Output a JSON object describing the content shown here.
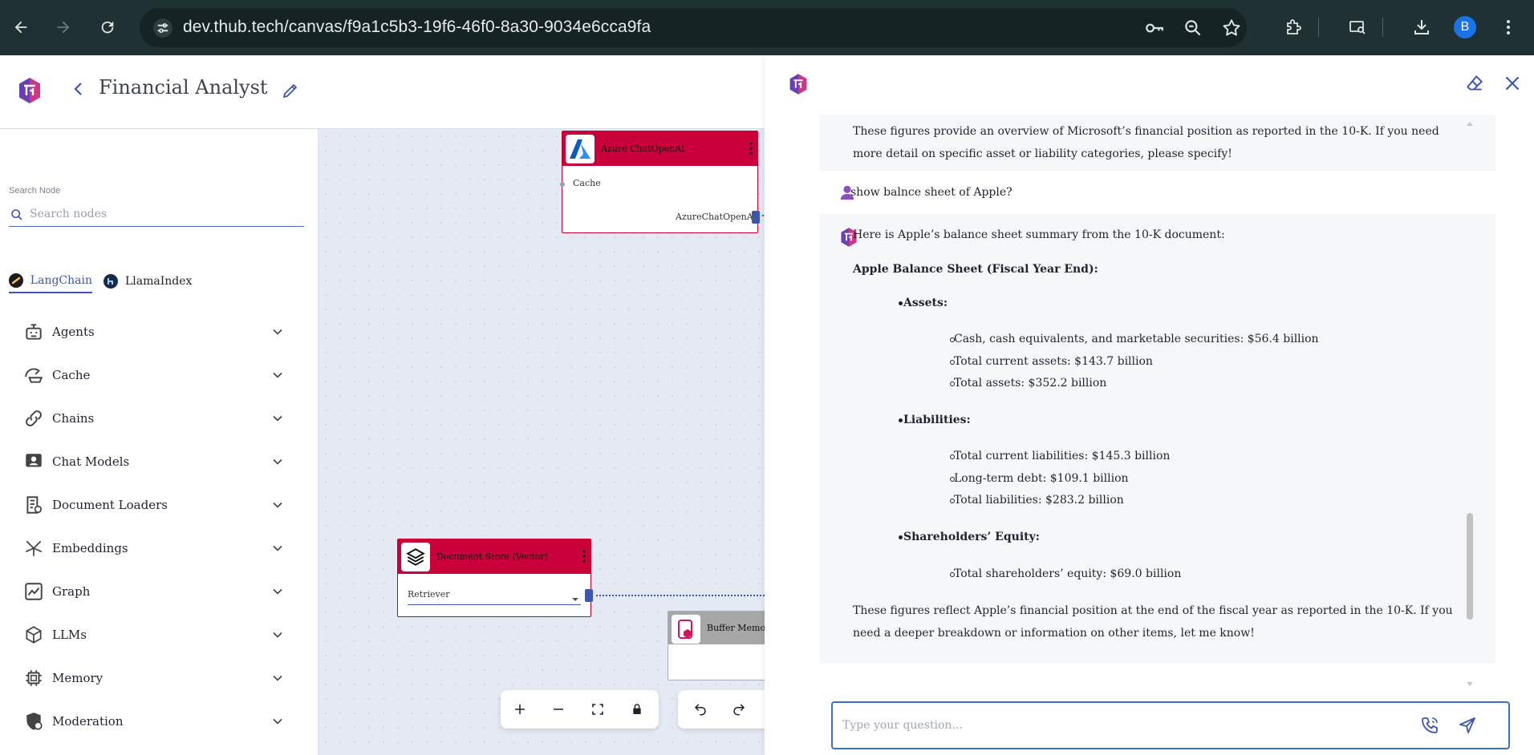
{
  "browser": {
    "url": "dev.thub.tech/canvas/f9a1c5b3-19f6-46f0-8a30-9034e6cca9fa",
    "profile_initial": "B"
  },
  "header": {
    "title": "Financial Analyst"
  },
  "sidebar": {
    "search_label": "Search Node",
    "search_placeholder": "Search nodes",
    "tabs": [
      {
        "label": "LangChain",
        "active": true
      },
      {
        "label": "LlamaIndex",
        "active": false
      }
    ],
    "categories": [
      {
        "label": "Agents",
        "icon": "robot-icon"
      },
      {
        "label": "Cache",
        "icon": "cache-icon"
      },
      {
        "label": "Chains",
        "icon": "link-icon"
      },
      {
        "label": "Chat Models",
        "icon": "chat-person-icon"
      },
      {
        "label": "Document Loaders",
        "icon": "document-icon"
      },
      {
        "label": "Embeddings",
        "icon": "vector-icon"
      },
      {
        "label": "Graph",
        "icon": "graph-icon"
      },
      {
        "label": "LLMs",
        "icon": "cube-icon"
      },
      {
        "label": "Memory",
        "icon": "chip-icon"
      },
      {
        "label": "Moderation",
        "icon": "shield-icon"
      }
    ]
  },
  "canvas": {
    "nodes": {
      "azure": {
        "title": "Azure ChatOpenAI",
        "input": "Cache",
        "output": "AzureChatOpenAI"
      },
      "docstore": {
        "title": "Document Store (Vector)",
        "output": "Retriever"
      },
      "buffer": {
        "title": "Buffer Memor"
      }
    }
  },
  "chat": {
    "input_placeholder": "Type your question...",
    "messages": {
      "prev_answer": [
        "These figures provide an overview of Microsoft’s financial position as reported in the 10-K. If you need",
        "more detail on specific asset or liability categories, please specify!"
      ],
      "user_question": "show balnce sheet of Apple?",
      "answer": {
        "intro": "Here is Apple’s balance sheet summary from the 10-K document:",
        "heading": "Apple Balance Sheet (Fiscal Year End):",
        "sections": [
          {
            "title": "Assets:",
            "items": [
              "Cash, cash equivalents, and marketable securities: $56.4 billion",
              "Total current assets: $143.7 billion",
              "Total assets: $352.2 billion"
            ]
          },
          {
            "title": "Liabilities:",
            "items": [
              "Total current liabilities: $145.3 billion",
              "Long-term debt: $109.1 billion",
              "Total liabilities: $283.2 billion"
            ]
          },
          {
            "title": "Shareholders’ Equity:",
            "items": [
              "Total shareholders’ equity: $69.0 billion"
            ]
          }
        ],
        "outro": [
          "These figures reflect Apple’s financial position at the end of the fiscal year as reported in the 10-K. If you",
          "need a deeper breakdown or information on other items, let me know!"
        ]
      }
    }
  },
  "colors": {
    "chrome_bg": "#203133",
    "accent_blue": "#3b55b5",
    "node_header": "#c9003a",
    "brand_purple": "#6a3fb5",
    "brand_pink": "#e0367c"
  }
}
